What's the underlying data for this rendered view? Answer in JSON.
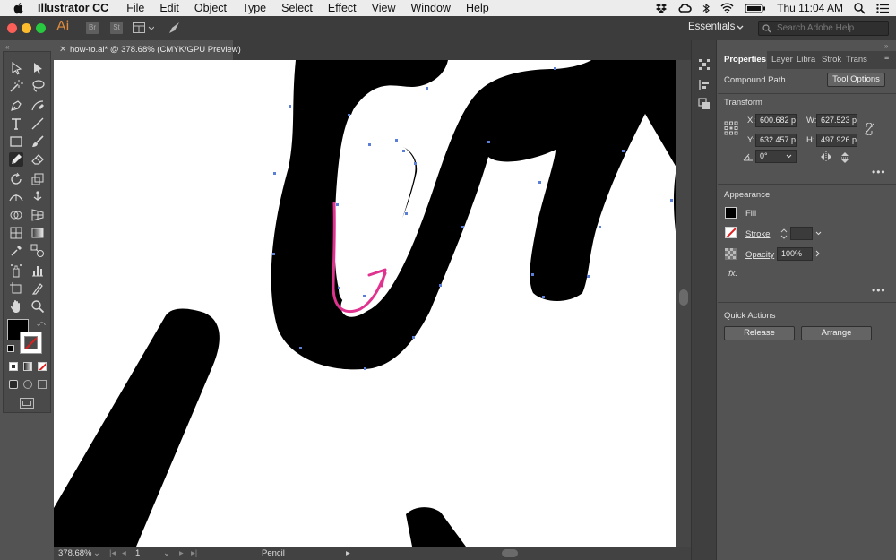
{
  "menubar": {
    "app_name": "Illustrator CC",
    "menus": [
      "File",
      "Edit",
      "Object",
      "Type",
      "Select",
      "Effect",
      "View",
      "Window",
      "Help"
    ],
    "clock": "Thu 11:04 AM"
  },
  "appbar": {
    "logo": "Ai",
    "workspace": "Essentials",
    "search_placeholder": "Search Adobe Help"
  },
  "document": {
    "tab_title": "how-to.ai* @ 378.68% (CMYK/GPU Preview)"
  },
  "statusbar": {
    "zoom": "378.68%",
    "artboard": "1",
    "current_tool": "Pencil"
  },
  "panel": {
    "tabs": [
      "Properties",
      "Layer",
      "Libra",
      "Strok",
      "Trans"
    ],
    "selection_type": "Compound Path",
    "tool_options_label": "Tool Options",
    "transform": {
      "heading": "Transform",
      "x_label": "X:",
      "x_value": "600.682 p",
      "y_label": "Y:",
      "y_value": "632.457 p",
      "w_label": "W:",
      "w_value": "627.523 p",
      "h_label": "H:",
      "h_value": "497.926 p",
      "angle_value": "0°"
    },
    "appearance": {
      "heading": "Appearance",
      "fill_label": "Fill",
      "stroke_label": "Stroke",
      "opacity_label": "Opacity",
      "opacity_value": "100%",
      "fx_label": "fx."
    },
    "quick_actions": {
      "heading": "Quick Actions",
      "release_label": "Release",
      "arrange_label": "Arrange"
    }
  },
  "colors": {
    "accent_path": "#5b7fd6",
    "pencil_stroke": "#e0328f",
    "logo": "#e08c3c"
  }
}
